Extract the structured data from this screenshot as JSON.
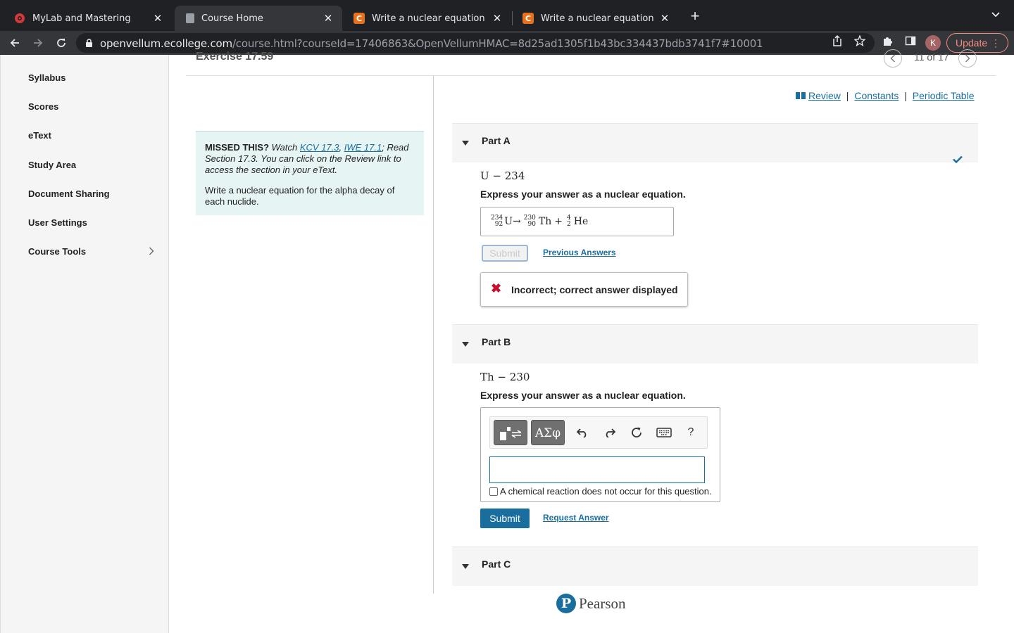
{
  "browser": {
    "tabs": [
      {
        "title": "MyLab and Mastering",
        "favicon": "pearson-favicon"
      },
      {
        "title": "Course Home",
        "favicon": "page-favicon"
      },
      {
        "title": "Write a nuclear equation for the",
        "favicon": "c-favicon",
        "icon_letter": "C"
      },
      {
        "title": "Write a nuclear equation for the",
        "favicon": "c-favicon",
        "icon_letter": "C"
      }
    ],
    "close_glyph": "✕",
    "new_tab_glyph": "+",
    "url_domain": "openvellum.ecollege.com",
    "url_path": "/course.html?courseId=17406863&OpenVellumHMAC=8d25ad1305f1b43bc334437bdb3741f7#10001",
    "profile_initial": "K",
    "update_label": "Update"
  },
  "sidebar": {
    "items": [
      "Syllabus",
      "Scores",
      "eText",
      "Study Area",
      "Document Sharing",
      "User Settings",
      "Course Tools"
    ]
  },
  "exercise": {
    "title": "Exercise 17.59",
    "pager": "11 of 17"
  },
  "missed": {
    "lead": "MISSED THIS?",
    "watch": " Watch ",
    "link1": "KCV 17.3",
    "comma": ", ",
    "link2": "IWE 17.1",
    "rest": "; Read Section 17.3. You can click on the Review link to access the section in your eText.",
    "instruction": "Write a nuclear equation for the alpha decay of each nuclide."
  },
  "resources": {
    "review": "Review",
    "sep": "|",
    "constants": "Constants",
    "periodic": "Periodic Table"
  },
  "partA": {
    "label": "Part A",
    "nuclide": "U − 234",
    "express": "Express your answer as a nuclear equation.",
    "answer": {
      "r_mass": "234",
      "r_z": "92",
      "r_sym": "U",
      "arrow": "→",
      "p1_mass": "230",
      "p1_z": "90",
      "p1_sym": "Th",
      "plus": "+",
      "p2_mass": "4",
      "p2_z": "2",
      "p2_sym": "He"
    },
    "submit": "Submit",
    "previous": "Previous Answers",
    "feedback_icon": "✖",
    "feedback": "Incorrect; correct answer displayed",
    "status": "correct-check-icon"
  },
  "partB": {
    "label": "Part B",
    "nuclide": "Th − 230",
    "express": "Express your answer as a nuclear equation.",
    "tools": {
      "greek": "ΑΣφ",
      "help": "?"
    },
    "input_value": "",
    "no_reaction": "A chemical reaction does not occur for this question.",
    "submit": "Submit",
    "request": "Request Answer"
  },
  "partC": {
    "label": "Part C"
  },
  "footer": {
    "logo_letter": "P",
    "brand": "Pearson"
  },
  "colors": {
    "accent": "#1a6e9e",
    "error": "#c8102e",
    "hint_bg": "#e6f4f4"
  }
}
